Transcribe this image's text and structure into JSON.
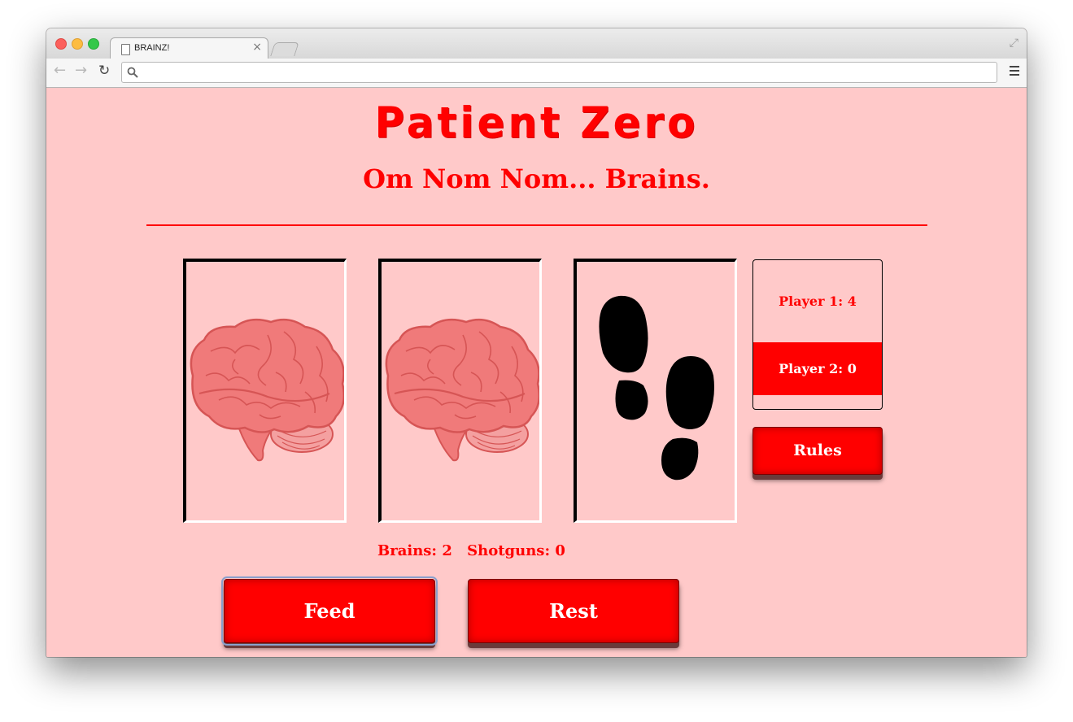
{
  "browser": {
    "tab_title": "BRAINZ!",
    "tab_close": "×",
    "url": ""
  },
  "game": {
    "title": "Patient Zero",
    "subtitle": "Om Nom Nom... Brains."
  },
  "dice": [
    {
      "face": "brain"
    },
    {
      "face": "brain"
    },
    {
      "face": "footsteps"
    }
  ],
  "scoreboard": {
    "player1": "Player 1: 4",
    "player2": "Player 2: 0",
    "active_player": 2
  },
  "buttons": {
    "rules": "Rules",
    "feed": "Feed",
    "rest": "Rest"
  },
  "stats": {
    "brains": "Brains: 2",
    "shotguns": "Shotguns: 0"
  },
  "colors": {
    "background": "#ffc9c9",
    "accent": "#ff0000",
    "brain": "#f07a7a"
  }
}
